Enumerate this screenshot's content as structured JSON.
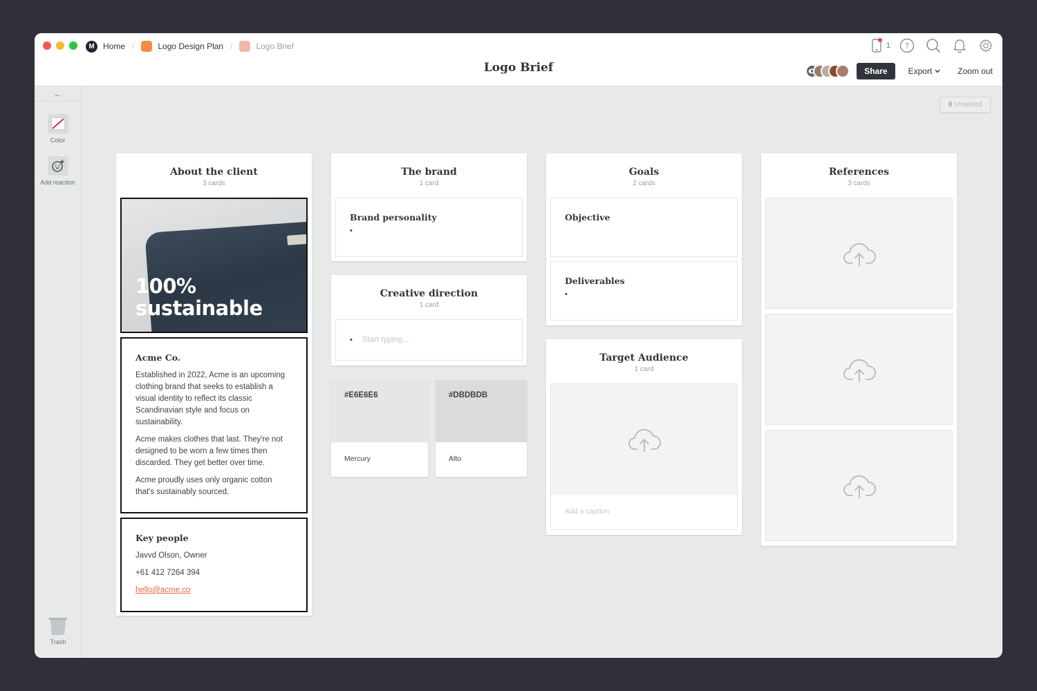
{
  "window": {
    "traffic_lights": [
      "#ee5b52",
      "#f5b82f",
      "#2dc443"
    ]
  },
  "breadcrumb": [
    {
      "label": "Home",
      "icon": "milanote-logo"
    },
    {
      "label": "Logo Design Plan",
      "icon_color": "#f98a3e"
    },
    {
      "label": "Logo Brief",
      "icon_color": "#f3b6ad"
    }
  ],
  "header": {
    "title": "Logo Brief",
    "device_count": "1",
    "share_label": "Share",
    "export_label": "Export",
    "zoom_label": "Zoom out"
  },
  "sidebar": {
    "back": "←",
    "tools": [
      {
        "label": "Color",
        "icon": "color-swatch-icon"
      },
      {
        "label": "Add reaction",
        "icon": "add-reaction-icon"
      }
    ],
    "trash_label": "Trash"
  },
  "canvas": {
    "unsorted_count": "0",
    "unsorted_label": "Unsorted"
  },
  "columns": {
    "about": {
      "title": "About the client",
      "count": "3 cards",
      "image_text_line1": "100%",
      "image_text_line2": "sustainable",
      "company_card": {
        "title": "Acme Co.",
        "paragraphs": [
          "Established in 2022, Acme is an upcoming clothing brand that seeks to establish a visual identity to reflect its classic Scandinavian style and focus on sustainability.",
          "Acme makes clothes that last. They're not designed to be worn a few times then discarded. They get better over time.",
          "Acme proudly uses only organic cotton that's sustainably sourced."
        ]
      },
      "people_card": {
        "title": "Key people",
        "name": "Javvd Olson, Owner",
        "phone": "+61 412 7264 394",
        "email": "hello@acme.co"
      }
    },
    "brand": {
      "title": "The brand",
      "count": "1 card",
      "card_title": "Brand personality",
      "bullet": "•"
    },
    "creative": {
      "title": "Creative direction",
      "count": "1 card",
      "placeholder": "Start typing..."
    },
    "swatches": [
      {
        "hex": "#E6E6E6",
        "name": "Mercury"
      },
      {
        "hex": "#DBDBDB",
        "name": "Alto"
      }
    ],
    "goals": {
      "title": "Goals",
      "count": "2 cards",
      "cards": [
        {
          "title": "Objective"
        },
        {
          "title": "Deliverables",
          "bullet": "•"
        }
      ]
    },
    "audience": {
      "title": "Target Audience",
      "count": "1 card",
      "caption_placeholder": "Add a caption"
    },
    "references": {
      "title": "References",
      "count": "3 cards"
    }
  }
}
